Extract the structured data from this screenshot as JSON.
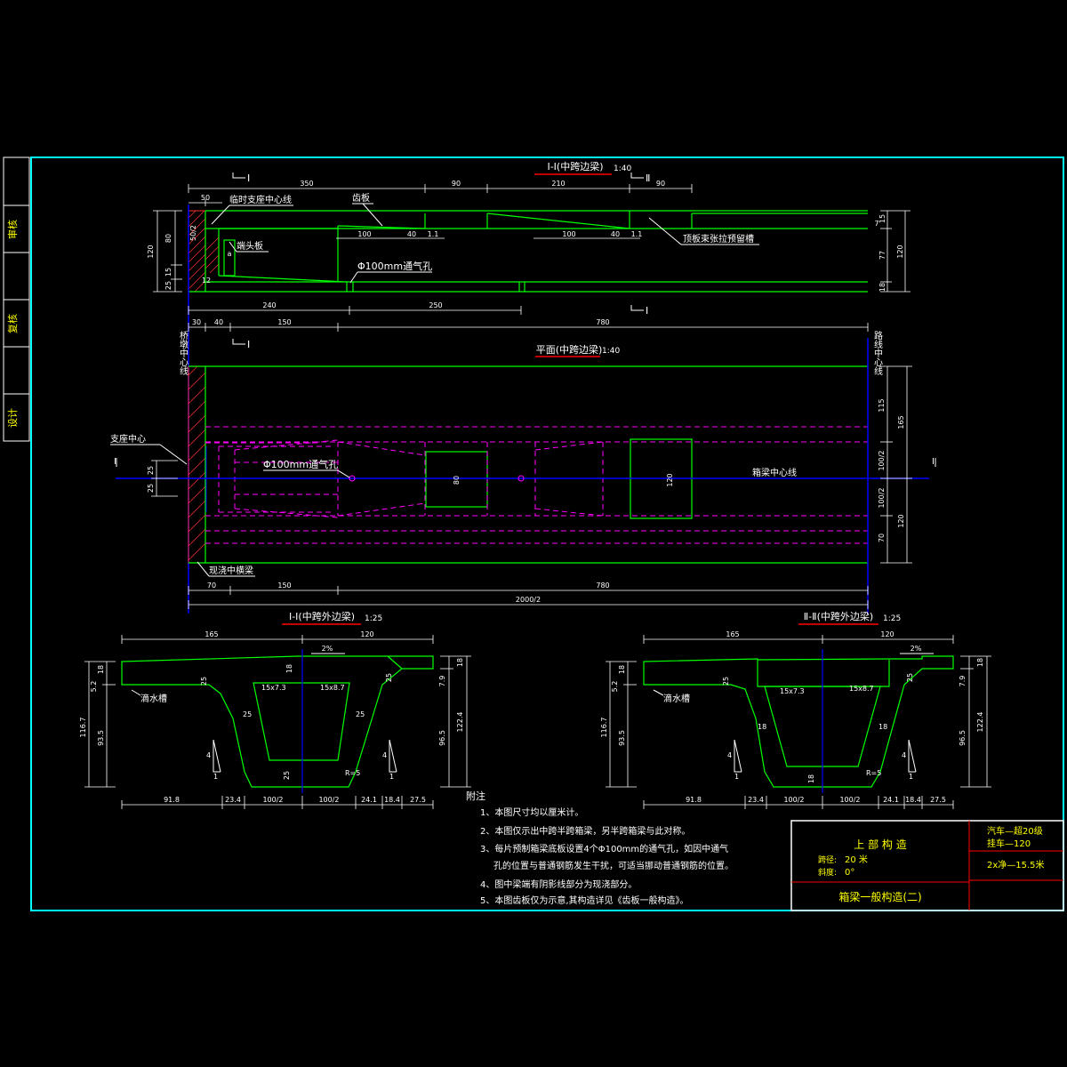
{
  "colors": {
    "background": "#000000",
    "frame": "#00ffff",
    "outline": "#00ff00",
    "hidden": "#ff00ff",
    "centerline": "#0000ff",
    "leader": "#ffffff",
    "text_yellow": "#ffff00",
    "text_white": "#ffffff",
    "title_red": "#ff0000",
    "hatch": "#ff3030"
  },
  "sidebar": {
    "review": "审核",
    "recheck": "复核",
    "design": "设计"
  },
  "elevation": {
    "title": "Ⅰ-Ⅰ(中跨边梁)",
    "scale": "1:40",
    "cut_label": "I",
    "cut_label_2": "Ⅱ",
    "labels": {
      "temp_bearing": "临时支座中心线",
      "tooth_block": "齿板",
      "end_plate": "端头板",
      "vent_hole": "Φ100mm通气孔",
      "top_tendon_slot": "顶板束张拉预留槽"
    },
    "dims_top": [
      "350",
      "90",
      "210",
      "90",
      "50"
    ],
    "dims_inner": [
      "100",
      "40",
      "1.1",
      "100",
      "40",
      "1.1",
      "a"
    ],
    "dims_left": [
      "120",
      "80",
      "25",
      "15",
      "12"
    ],
    "dims_left_small": "50/2",
    "dims_right": [
      "15",
      "77",
      "120",
      "18"
    ],
    "dims_right_small": "7",
    "dims_bottom": [
      "240",
      "250"
    ],
    "dims_row": [
      "30",
      "40",
      "150",
      "780"
    ]
  },
  "plan": {
    "title": "平面(中跨边梁)",
    "scale": "1:40",
    "left_axis": "桥墩中心线",
    "right_axis": "路线中心线",
    "labels": {
      "bearing_center": "支座中心",
      "vent_hole": "Φ100mm通气孔",
      "girder_center": "箱梁中心线",
      "cast_beam": "现浇中横梁"
    },
    "cut_label": "I",
    "dims_left": [
      "25",
      "25"
    ],
    "dims_inner": [
      "80",
      "120"
    ],
    "dims_right": [
      "115",
      "165",
      "100/2",
      "100/2",
      "120",
      "70"
    ],
    "dims_bottom": [
      "70",
      "150",
      "780",
      "2000/2"
    ]
  },
  "section1": {
    "title": "Ⅰ-Ⅰ(中跨外边梁)",
    "scale": "1:25",
    "drain": "滴水槽",
    "slope": "2%",
    "dims_top": [
      "165",
      "120"
    ],
    "dims_left": [
      "18",
      "5.2",
      "116.7",
      "93.5"
    ],
    "dims_right": [
      "18",
      "7.9",
      "122.4",
      "96.5"
    ],
    "dims_inner": [
      "25",
      "25",
      "25",
      "25",
      "18",
      "25",
      "15x7.3",
      "15x8.7",
      "R=5"
    ],
    "dims_bottom": [
      "91.8",
      "23.4",
      "100/2",
      "100/2",
      "24.1",
      "18.4",
      "27.5"
    ],
    "slope_marks": [
      "4",
      "1",
      "4",
      "1"
    ]
  },
  "section2": {
    "title": "Ⅱ-Ⅱ(中跨外边梁)",
    "scale": "1:25",
    "drain": "滴水槽",
    "slope": "2%",
    "dims_top": [
      "165",
      "120"
    ],
    "dims_left": [
      "18",
      "5.2",
      "116.7",
      "93.5"
    ],
    "dims_right": [
      "18",
      "7.9",
      "122.4",
      "96.5"
    ],
    "dims_inner": [
      "25",
      "18",
      "18",
      "25",
      "18",
      "15x7.3",
      "15x8.7",
      "R=5"
    ],
    "dims_bottom": [
      "91.8",
      "23.4",
      "100/2",
      "100/2",
      "24.1",
      "18.4",
      "27.5"
    ],
    "slope_marks": [
      "4",
      "1",
      "4",
      "1"
    ]
  },
  "notes": {
    "heading": "附注",
    "items": [
      "1、本图尺寸均以厘米计。",
      "2、本图仅示出中跨半跨箱梁，另半跨箱梁与此对称。",
      "3、每片预制箱梁底板设置4个Φ100mm的通气孔，如因中通气",
      "孔的位置与普通钢筋发生干扰，可适当挪动普通钢筋的位置。",
      "4、图中梁端有阴影线部分为现浇部分。",
      "5、本图齿板仅为示意,其构造详见《齿板一般构造》。"
    ]
  },
  "titleblock": {
    "project": "上 部 构 造",
    "span_label": "跨径:",
    "span_value": "20 米",
    "skew_label": "斜度:",
    "skew_value": "0°",
    "drawing_title": "箱梁一般构造(二)",
    "load_line1": "汽车—超20级",
    "load_line2": "挂车—120",
    "width": "2x净—15.5米"
  }
}
